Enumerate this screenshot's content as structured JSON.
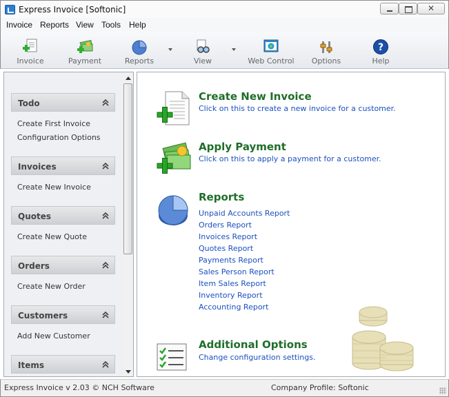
{
  "window": {
    "title": "Express Invoice [Softonic]",
    "close_glyph": "✕"
  },
  "menu": [
    "Invoice",
    "Reports",
    "View",
    "Tools",
    "Help"
  ],
  "toolbar": [
    {
      "label": "Invoice",
      "icon": "new-invoice-icon"
    },
    {
      "label": "Payment",
      "icon": "payment-icon"
    },
    {
      "label": "Reports",
      "icon": "reports-pie-icon",
      "dropdown": true
    },
    {
      "label": "View",
      "icon": "view-icon",
      "dropdown": true
    },
    {
      "label": "Web Control",
      "icon": "web-control-icon"
    },
    {
      "label": "Options",
      "icon": "options-icon"
    },
    {
      "label": "Help",
      "icon": "help-icon"
    }
  ],
  "sidebar": {
    "sections": [
      {
        "title": "Todo",
        "items": [
          "Create First Invoice",
          "Configuration Options"
        ]
      },
      {
        "title": "Invoices",
        "items": [
          "Create New Invoice"
        ]
      },
      {
        "title": "Quotes",
        "items": [
          "Create New Quote"
        ]
      },
      {
        "title": "Orders",
        "items": [
          "Create New Order"
        ]
      },
      {
        "title": "Customers",
        "items": [
          "Add New Customer"
        ]
      },
      {
        "title": "Items",
        "items": []
      }
    ]
  },
  "main": {
    "create_invoice": {
      "title": "Create New Invoice",
      "desc": "Click on this to create a new invoice for a customer."
    },
    "apply_payment": {
      "title": "Apply Payment",
      "desc": "Click on this to apply a payment for a customer."
    },
    "reports": {
      "title": "Reports",
      "links": [
        "Unpaid Accounts Report",
        "Orders Report",
        "Invoices Report",
        "Quotes Report",
        "Payments Report",
        "Sales Person Report",
        "Item Sales Report",
        "Inventory Report",
        "Accounting Report"
      ]
    },
    "additional_options": {
      "title": "Additional Options",
      "desc": "Change configuration settings."
    }
  },
  "status": {
    "left": "Express Invoice v 2.03 © NCH Software",
    "right": "Company Profile: Softonic"
  },
  "colors": {
    "action_title": "#1f6e2a",
    "link": "#1b4fbf"
  }
}
